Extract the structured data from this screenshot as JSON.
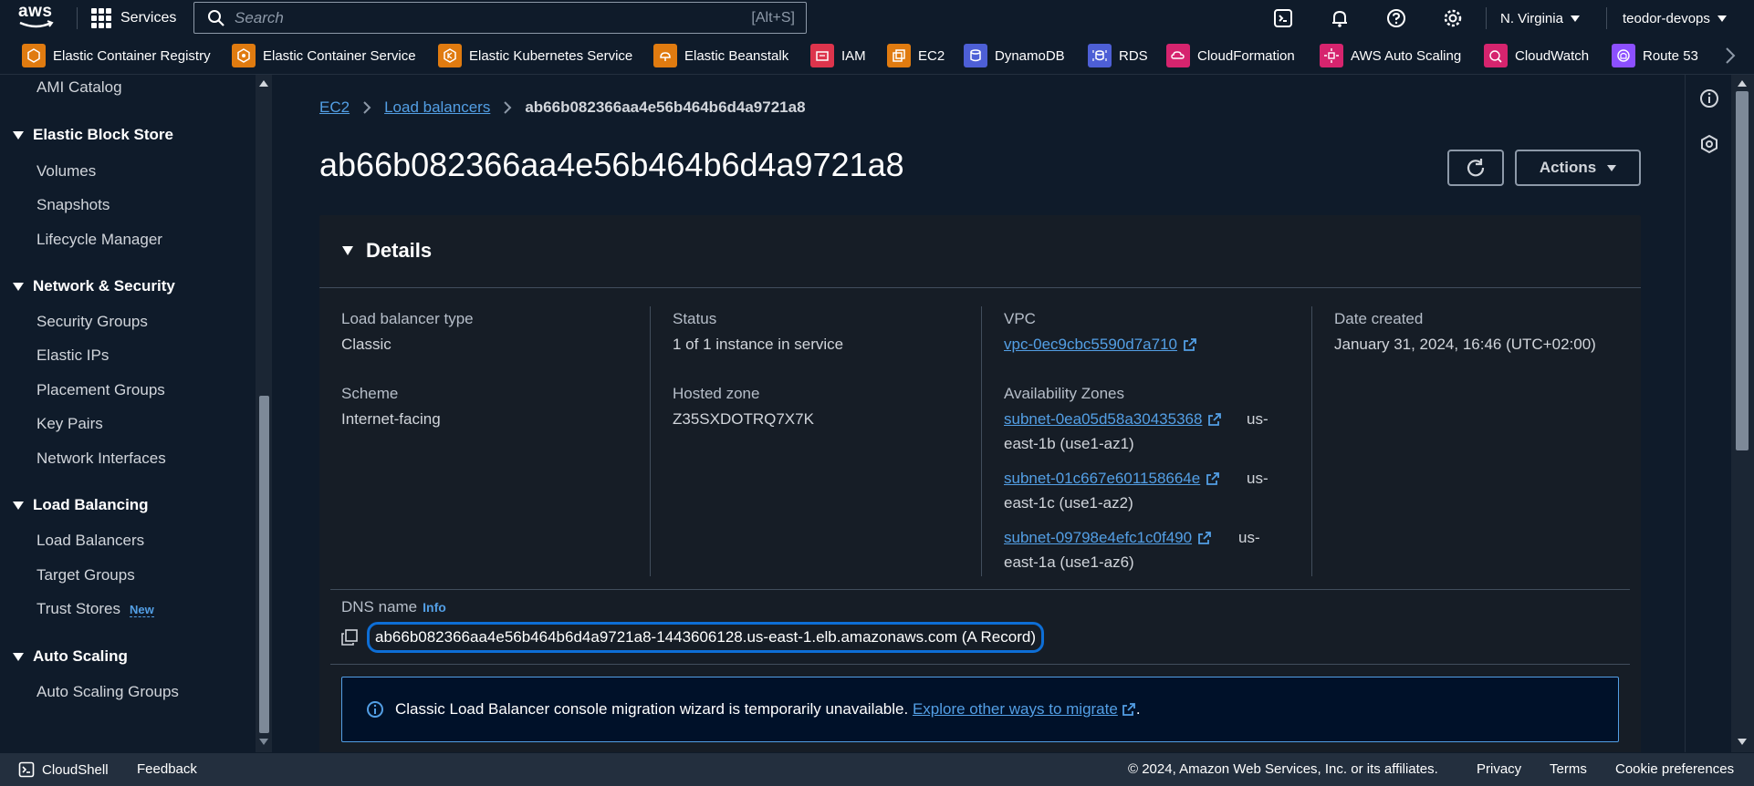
{
  "topnav": {
    "logo_text": "aws",
    "services_label": "Services",
    "search_placeholder": "Search",
    "search_shortcut": "[Alt+S]",
    "region": "N. Virginia",
    "account": "teodor-devops"
  },
  "favorites": [
    {
      "label": "Elastic Container Registry",
      "icon": "ecr-icon",
      "color": "#e07b10"
    },
    {
      "label": "Elastic Container Service",
      "icon": "ecs-icon",
      "color": "#e07b10"
    },
    {
      "label": "Elastic Kubernetes Service",
      "icon": "eks-icon",
      "color": "#e07b10"
    },
    {
      "label": "Elastic Beanstalk",
      "icon": "beanstalk-icon",
      "color": "#e07b10"
    },
    {
      "label": "IAM",
      "icon": "iam-icon",
      "color": "#dd344c"
    },
    {
      "label": "EC2",
      "icon": "ec2-icon",
      "color": "#e07b10"
    },
    {
      "label": "DynamoDB",
      "icon": "dynamodb-icon",
      "color": "#4d5fd6"
    },
    {
      "label": "RDS",
      "icon": "rds-icon",
      "color": "#4d5fd6"
    },
    {
      "label": "CloudFormation",
      "icon": "cloudformation-icon",
      "color": "#d6246e"
    },
    {
      "label": "AWS Auto Scaling",
      "icon": "autoscaling-icon",
      "color": "#d6246e"
    },
    {
      "label": "CloudWatch",
      "icon": "cloudwatch-icon",
      "color": "#d6246e"
    },
    {
      "label": "Route 53",
      "icon": "route53-icon",
      "color": "#8c4fff"
    }
  ],
  "sidebar": {
    "top_item": "AMI Catalog",
    "ebs": {
      "title": "Elastic Block Store",
      "items": [
        "Volumes",
        "Snapshots",
        "Lifecycle Manager"
      ]
    },
    "network": {
      "title": "Network & Security",
      "items": [
        "Security Groups",
        "Elastic IPs",
        "Placement Groups",
        "Key Pairs",
        "Network Interfaces"
      ]
    },
    "lb": {
      "title": "Load Balancing",
      "items": [
        "Load Balancers",
        "Target Groups",
        "Trust Stores"
      ],
      "new_badge": "New"
    },
    "asg": {
      "title": "Auto Scaling",
      "items": [
        "Auto Scaling Groups"
      ]
    }
  },
  "breadcrumb": {
    "ec2": "EC2",
    "load_balancers": "Load balancers",
    "current": "ab66b082366aa4e56b464b6d4a9721a8"
  },
  "page": {
    "title": "ab66b082366aa4e56b464b6d4a9721a8",
    "actions_label": "Actions"
  },
  "details": {
    "title": "Details",
    "lb_type_label": "Load balancer type",
    "lb_type_value": "Classic",
    "scheme_label": "Scheme",
    "scheme_value": "Internet-facing",
    "status_label": "Status",
    "status_value": "1 of 1 instance in service",
    "hosted_zone_label": "Hosted zone",
    "hosted_zone_value": "Z35SXDOTRQ7X7K",
    "vpc_label": "VPC",
    "vpc_value": "vpc-0ec9cbc5590d7a710",
    "az_label": "Availability Zones",
    "zones": [
      {
        "subnet": "subnet-0ea05d58a30435368",
        "suffix1": "us-",
        "suffix2": "east-1b (use1-az1)"
      },
      {
        "subnet": "subnet-01c667e601158664e",
        "suffix1": "us-",
        "suffix2": "east-1c (use1-az2)"
      },
      {
        "subnet": "subnet-09798e4efc1c0f490",
        "suffix1": "us-",
        "suffix2": "east-1a (use1-az6)"
      }
    ],
    "date_label": "Date created",
    "date_value": "January 31, 2024, 16:46 (UTC+02:00)",
    "dns_label": "DNS name",
    "dns_info": "Info",
    "dns_value": "ab66b082366aa4e56b464b6d4a9721a8-1443606128.us-east-1.elb.amazonaws.com (A Record)"
  },
  "alert": {
    "text": "Classic Load Balancer console migration wizard is temporarily unavailable. ",
    "link": "Explore other ways to migrate",
    "tail": "."
  },
  "footer": {
    "cloudshell": "CloudShell",
    "feedback": "Feedback",
    "copyright": "© 2024, Amazon Web Services, Inc. or its affiliates.",
    "privacy": "Privacy",
    "terms": "Terms",
    "cookies": "Cookie preferences"
  },
  "colors": {
    "background": "#0f1b2a",
    "panel": "#161d26",
    "link": "#539fe5",
    "highlight": "#0d6ed6"
  }
}
